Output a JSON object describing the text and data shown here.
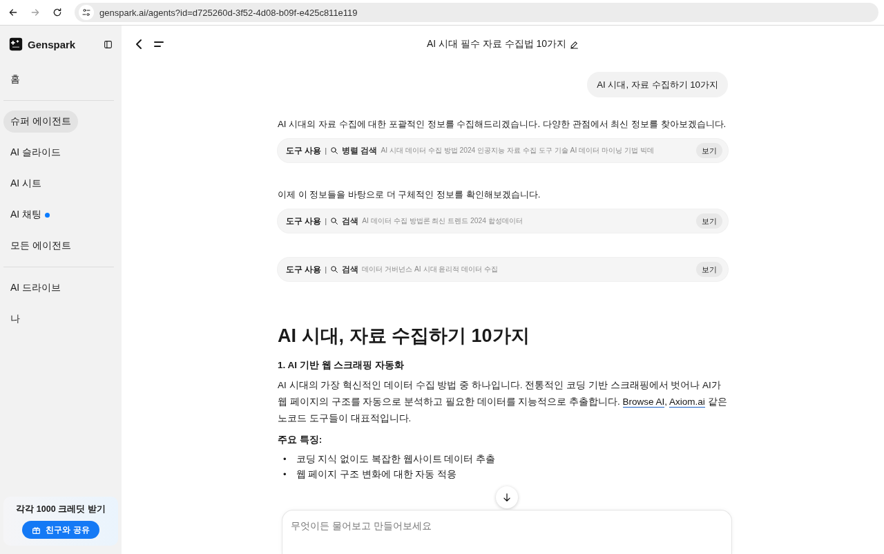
{
  "browser": {
    "nav_buttons": [
      {
        "kind": "back",
        "disabled": false
      },
      {
        "kind": "forward",
        "disabled": true
      },
      {
        "kind": "reload",
        "disabled": false
      }
    ],
    "url": "genspark.ai/agents?id=d725260d-3f52-4d08-b09f-e425c811e119"
  },
  "sidebar": {
    "brand": "Genspark",
    "groups": [
      [
        {
          "label": "홈",
          "selected": false,
          "dot": false
        }
      ],
      [
        {
          "label": "슈퍼 에이전트",
          "selected": true,
          "dot": false
        },
        {
          "label": "AI 슬라이드",
          "selected": false,
          "dot": false
        },
        {
          "label": "AI 시트",
          "selected": false,
          "dot": false
        },
        {
          "label": "AI 채팅",
          "selected": false,
          "dot": true
        },
        {
          "label": "모든 에이전트",
          "selected": false,
          "dot": false
        }
      ],
      [
        {
          "label": "AI 드라이브",
          "selected": false,
          "dot": false
        },
        {
          "label": "나",
          "selected": false,
          "dot": false
        }
      ]
    ],
    "promo": {
      "title": "각각 1000 크레딧 받기",
      "button": "친구와 공유"
    }
  },
  "header": {
    "title": "AI 시대 필수 자료 수집법 10가지"
  },
  "chat": [
    {
      "kind": "user",
      "text": "AI 시대, 자료 수집하기 10가지"
    },
    {
      "kind": "text",
      "text": "AI 시대의 자료 수집에 대한 포괄적인 정보를 수집해드리겠습니다. 다양한 관점에서 최신 정보를 찾아보겠습니다."
    },
    {
      "kind": "tool",
      "label": "도구 사용",
      "separator": "|",
      "tool": "병렬 검색",
      "query": "AI 시대 데이터 수집 방법 2024 인공지능 자료 수집 도구 기술 AI 데이터 마이닝 기법 빅데",
      "button": "보기"
    },
    {
      "kind": "text",
      "text": "이제 이 정보들을 바탕으로 더 구체적인 정보를 확인해보겠습니다."
    },
    {
      "kind": "tool",
      "label": "도구 사용",
      "separator": "|",
      "tool": "검색",
      "query": "AI 데이터 수집 방법론 최신 트렌드 2024 합성데이터",
      "button": "보기"
    },
    {
      "kind": "tool",
      "label": "도구 사용",
      "separator": "|",
      "tool": "검색",
      "query": "데이터 거버넌스 AI 시대 윤리적 데이터 수집",
      "button": "보기"
    },
    {
      "kind": "heading",
      "text": "AI 시대, 자료 수집하기 10가지"
    },
    {
      "kind": "subheading",
      "text": "1. AI 기반 웹 스크래핑 자동화"
    },
    {
      "kind": "paragraph",
      "parts": [
        {
          "kind": "text",
          "text": "AI 시대의 가장 혁신적인 데이터 수집 방법 중 하나입니다. 전통적인 코딩 기반 스크래핑에서 벗어나 AI가 웹 페이지의 구조를 자동으로 분석하고 필요한 데이터를 지능적으로 추출합니다. "
        },
        {
          "kind": "link",
          "text": "Browse AI"
        },
        {
          "kind": "text",
          "text": ", "
        },
        {
          "kind": "link",
          "text": "Axiom.ai"
        },
        {
          "kind": "text",
          "text": " 같은 노코드 도구들이 대표적입니다."
        }
      ]
    },
    {
      "kind": "label",
      "text": "주요 특징:"
    },
    {
      "kind": "list",
      "items": [
        {
          "marker": "•",
          "text": "코딩 지식 없이도 복잡한 웹사이트 데이터 추출"
        },
        {
          "marker": "•",
          "text": "웹 페이지 구조 변화에 대한 자동 적응"
        }
      ]
    }
  ],
  "composer": {
    "placeholder": "무엇이든 물어보고 만들어보세요"
  }
}
